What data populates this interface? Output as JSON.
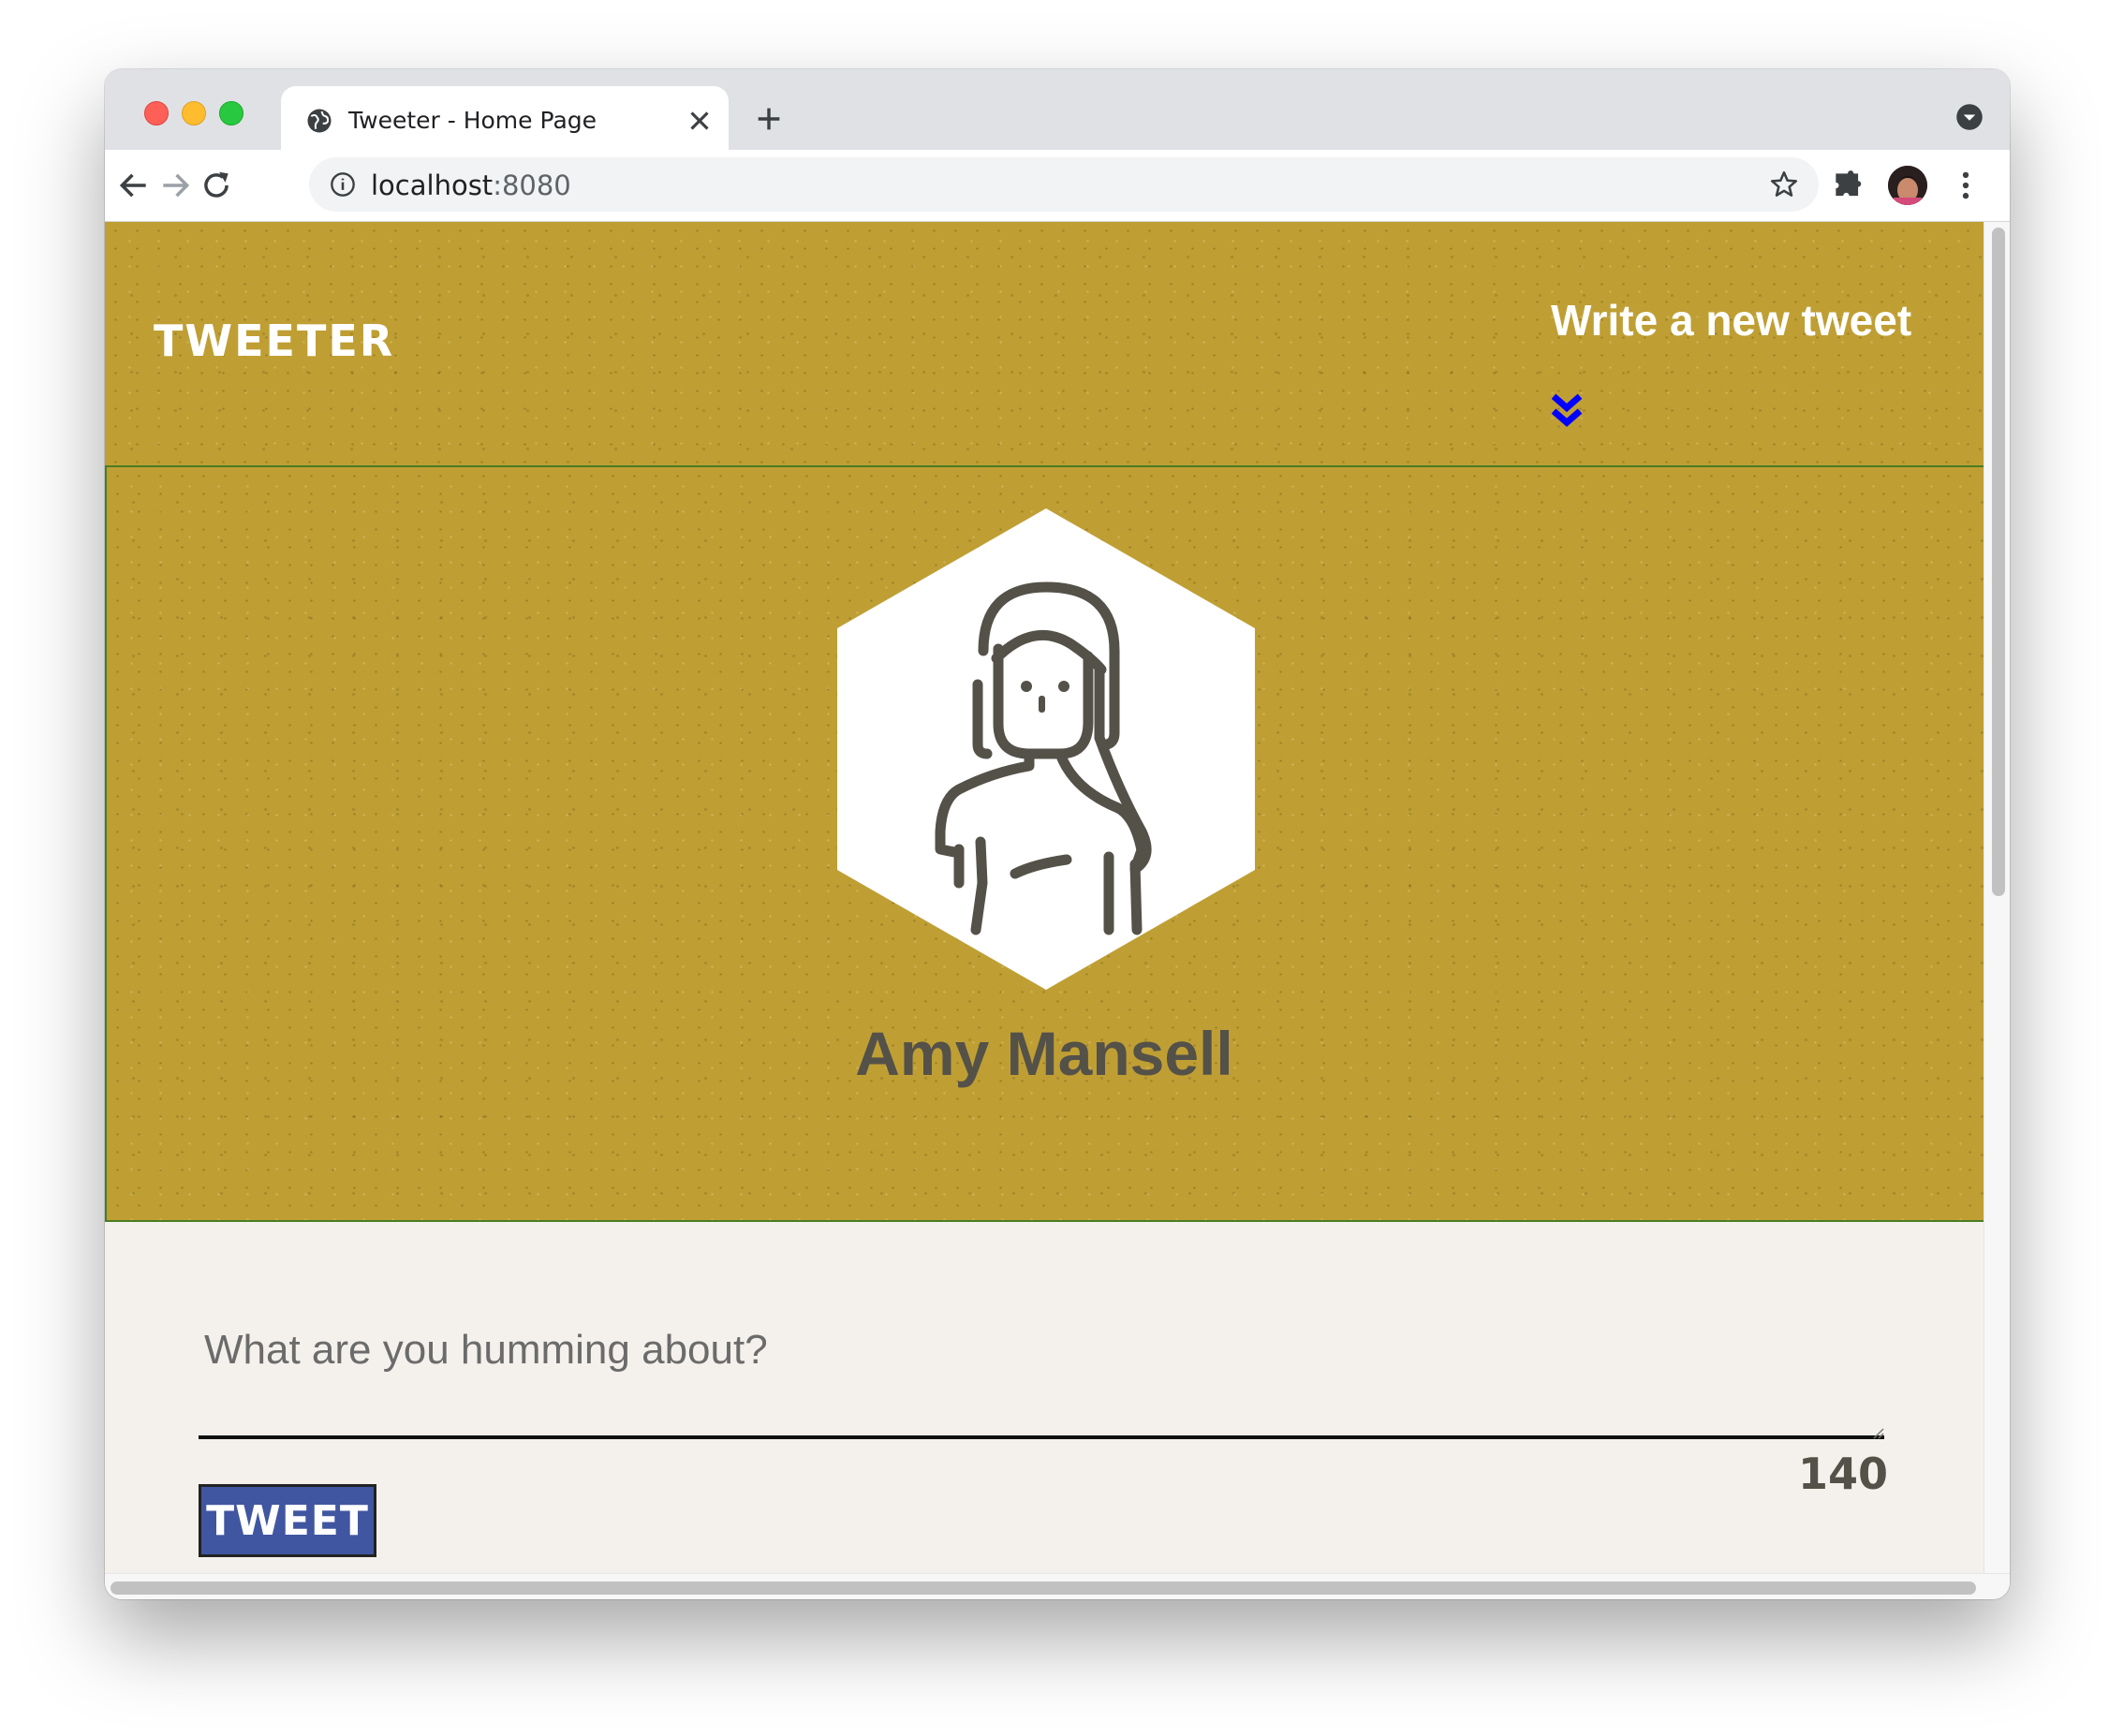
{
  "browser": {
    "tab_title": "Tweeter - Home Page",
    "url_host": "localhost",
    "url_port": ":8080",
    "icons": [
      "globe-icon",
      "close-icon",
      "plus-icon",
      "tab-menu-icon",
      "back-arrow-icon",
      "forward-arrow-icon",
      "reload-icon",
      "info-icon",
      "star-icon",
      "extensions-icon",
      "profile-avatar",
      "kebab-menu-icon"
    ]
  },
  "nav": {
    "brand": "TWEETER",
    "write_link": "Write a new tweet",
    "chevron_icon": "double-chevron-down-icon",
    "chevron_color": "#0000ff"
  },
  "profile": {
    "name": "Amy Mansell",
    "avatar_icon": "woman-avatar-icon",
    "background_color": "#bf9f34"
  },
  "composer": {
    "placeholder": "What are you humming about?",
    "value": "",
    "counter": "140",
    "submit_label": "TWEET",
    "submit_color": "#4056a1"
  }
}
